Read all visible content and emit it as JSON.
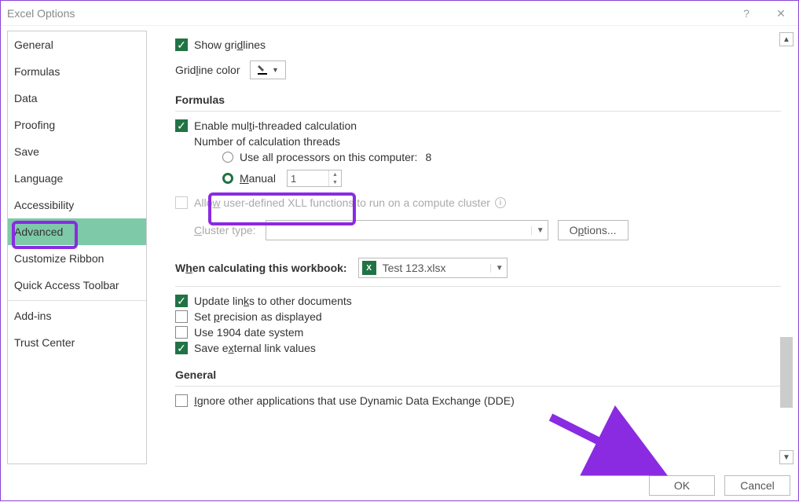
{
  "window": {
    "title": "Excel Options"
  },
  "sidebar": {
    "items": [
      "General",
      "Formulas",
      "Data",
      "Proofing",
      "Save",
      "Language",
      "Accessibility",
      "Advanced",
      "Customize Ribbon",
      "Quick Access Toolbar",
      "Add-ins",
      "Trust Center"
    ],
    "selected": "Advanced"
  },
  "display": {
    "show_gridlines": "Show gridlines",
    "gridline_color": "Gridline color"
  },
  "formulas": {
    "heading": "Formulas",
    "enable_multithread": "Enable multi-threaded calculation",
    "num_threads_label": "Number of calculation threads",
    "use_all_processors": "Use all processors on this computer:",
    "processor_count": "8",
    "manual_label": "Manual",
    "manual_value": "1",
    "allow_xll": "Allow user-defined XLL functions to run on a compute cluster",
    "cluster_type_label": "Cluster type:",
    "options_btn": "Options..."
  },
  "workbook_calc": {
    "heading": "When calculating this workbook:",
    "workbook_name": "Test 123.xlsx",
    "update_links": "Update links to other documents",
    "set_precision": "Set precision as displayed",
    "use_1904": "Use 1904 date system",
    "save_external": "Save external link values"
  },
  "general": {
    "heading": "General",
    "ignore_dde": "Ignore other applications that use Dynamic Data Exchange (DDE)"
  },
  "footer": {
    "ok": "OK",
    "cancel": "Cancel"
  }
}
